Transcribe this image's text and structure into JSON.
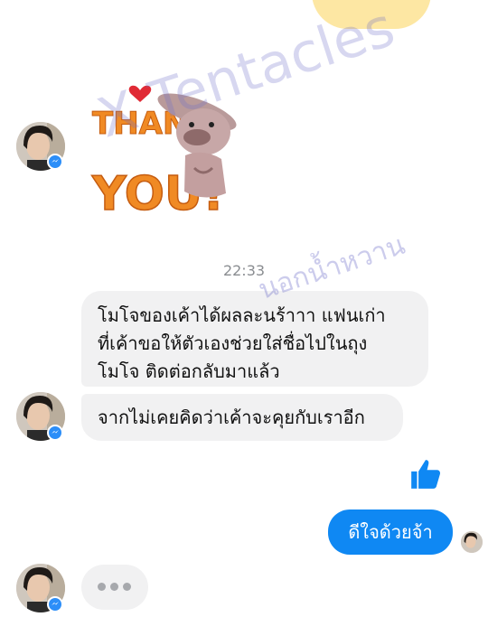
{
  "watermark": {
    "main": "X Tentacles",
    "secondary": "นอกน้ำหวาน"
  },
  "sticker": {
    "text_line1": "THANK",
    "text_line2": "YOU!"
  },
  "chat": {
    "timestamp": "22:33",
    "messages_in": [
      {
        "lines": [
          "โมโจของเค้าได้ผลละนร้าาา แฟนเก่า",
          "ที่เค้าขอให้ตัวเองช่วยใส่ชื่อไปในถุง",
          "โมโจ ติดต่อกลับมาแล้ว"
        ]
      },
      {
        "text": "จากไม่เคยคิดว่าเค้าจะคุยกับเราอีก"
      }
    ],
    "message_out": "ดีใจด้วยจ้า"
  },
  "colors": {
    "outgoing_bubble": "#0f88f3",
    "incoming_bubble": "#f1f1f2",
    "like": "#0f88f3",
    "messenger_badge": "#2c8ef8",
    "top_bubble": "#fde7a3"
  },
  "icons": {
    "like": "thumbs-up-icon",
    "badge": "messenger-icon",
    "typing": "typing-dots-icon"
  }
}
